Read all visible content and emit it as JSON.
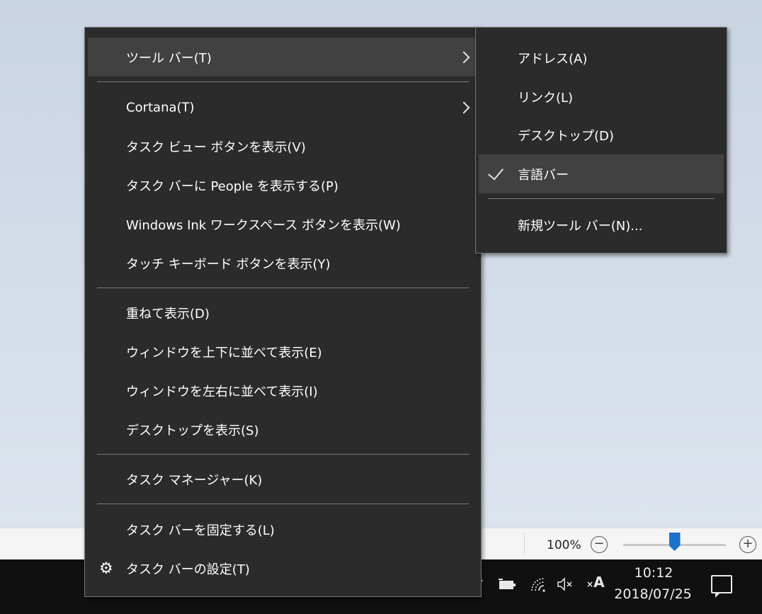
{
  "main_menu": {
    "toolbar": "ツール バー(T)",
    "cortana": "Cortana(T)",
    "task_view": "タスク ビュー ボタンを表示(V)",
    "people": "タスク バーに People を表示する(P)",
    "windows_ink": "Windows Ink ワークスペース ボタンを表示(W)",
    "touch_keyboard": "タッチ キーボード ボタンを表示(Y)",
    "cascade": "重ねて表示(D)",
    "stacked": "ウィンドウを上下に並べて表示(E)",
    "side_by_side": "ウィンドウを左右に並べて表示(I)",
    "show_desktop": "デスクトップを表示(S)",
    "task_manager": "タスク マネージャー(K)",
    "lock_taskbar": "タスク バーを固定する(L)",
    "taskbar_settings": "タスク バーの設定(T)"
  },
  "toolbar_submenu": {
    "address": "アドレス(A)",
    "links": "リンク(L)",
    "desktop": "デスクトップ(D)",
    "language_bar": "言語バー",
    "language_bar_checked": true,
    "new_toolbar": "新規ツール バー(N)..."
  },
  "zoom": {
    "label": "100%",
    "level_fraction": 0.5,
    "minus_glyph": "−",
    "plus_glyph": "+"
  },
  "tray": {
    "time": "10:12",
    "date": "2018/07/25",
    "ime_glyph": "A"
  },
  "colors": {
    "menu_bg": "#2b2b2b",
    "menu_highlight": "#414141",
    "taskbar_bg": "#101010",
    "zoom_thumb": "#1a73c9"
  }
}
